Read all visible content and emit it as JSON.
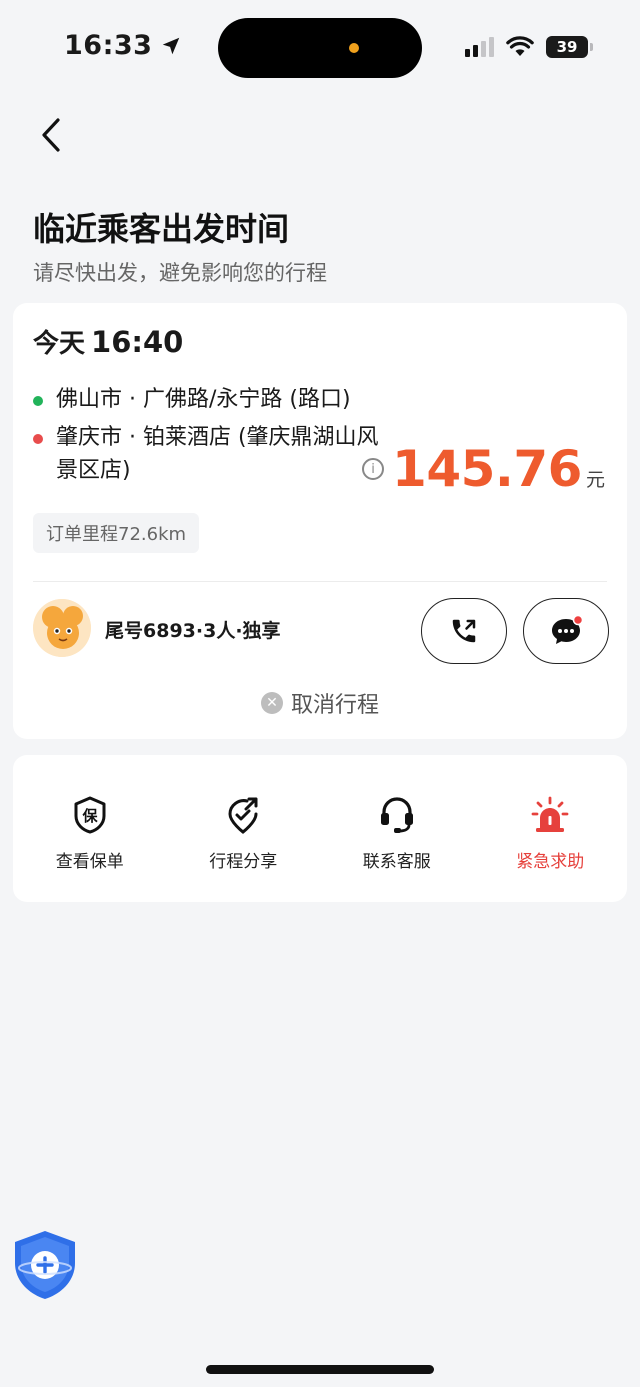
{
  "status_bar": {
    "time": "16:33",
    "battery": "39"
  },
  "header": {
    "title": "临近乘客出发时间",
    "subtitle": "请尽快出发，避免影响您的行程"
  },
  "trip": {
    "day": "今天",
    "time": "16:40",
    "from": "佛山市 · 广佛路/永宁路 (路口)",
    "to": "肇庆市 · 铂莱酒店 (肇庆鼎湖山风景区店)",
    "price": "145.76",
    "unit": "元",
    "mileage": "订单里程72.6km",
    "passenger": "尾号6893·3人·独享",
    "cancel": "取消行程"
  },
  "actions": [
    {
      "label": "查看保单",
      "icon": "policy-icon"
    },
    {
      "label": "行程分享",
      "icon": "share-trip-icon"
    },
    {
      "label": "联系客服",
      "icon": "customer-service-icon"
    },
    {
      "label": "紧急求助",
      "icon": "emergency-siren-icon"
    }
  ],
  "colors": {
    "price": "#ee5b2e",
    "from_dot": "#22b35a",
    "to_dot": "#e84c4c",
    "emergency": "#e6413c",
    "shield": "#2f6fe8"
  },
  "icons": {
    "info": "i",
    "cancel": "✕",
    "policy_glyph": "保",
    "battery_icon": "battery-icon",
    "wifi_icon": "wifi-icon",
    "signal_icon": "signal-icon",
    "location_icon": "location-arrow-icon"
  }
}
